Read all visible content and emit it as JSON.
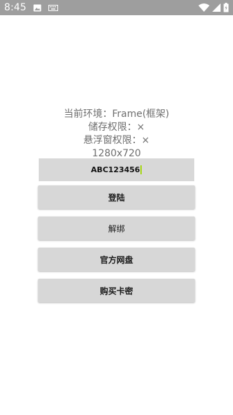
{
  "status_bar": {
    "time": "8:45",
    "icons": [
      "image-icon",
      "keyboard-icon",
      "wifi-icon",
      "signal-icon",
      "battery-charging-icon"
    ]
  },
  "info": {
    "environment": "当前环境：Frame(框架)",
    "storage_permission": "储存权限：×",
    "overlay_permission": "悬浮窗权限：×",
    "resolution": "1280x720"
  },
  "key_input": {
    "value": "ABC123456"
  },
  "buttons": {
    "login": "登陆",
    "unbind": "解绑",
    "official_cloud": "官方网盘",
    "buy_key": "购买卡密"
  },
  "colors": {
    "status_bar": "#9e9e9e",
    "button_bg": "#d7d7d7",
    "info_text": "#6e6e6e",
    "cursor": "#a5d610"
  }
}
